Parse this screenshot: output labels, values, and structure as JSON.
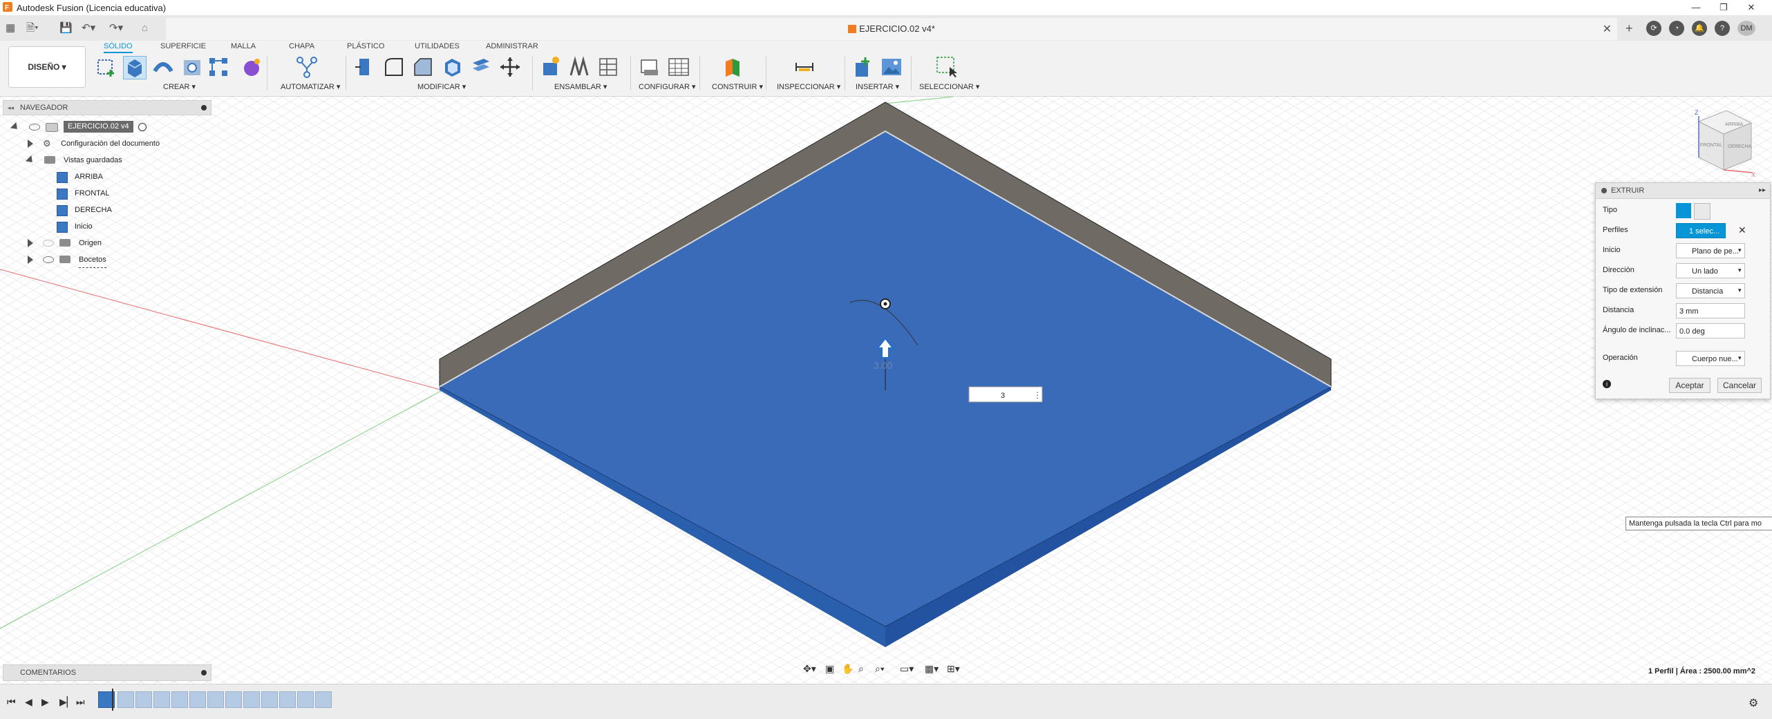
{
  "window": {
    "title": "Autodesk Fusion (Licencia educativa)",
    "controls": [
      "—",
      "❐",
      "✕"
    ]
  },
  "tabbar": {
    "document_title": "EJERCICIO.02 v4*",
    "user_initials": "DM"
  },
  "toolbar": {
    "workspace": "DISEÑO ▾",
    "tabs": [
      "SÓLIDO",
      "SUPERFICIE",
      "MALLA",
      "CHAPA",
      "PLÁSTICO",
      "UTILIDADES",
      "ADMINISTRAR"
    ],
    "groups": [
      "CREAR ▾",
      "AUTOMATIZAR ▾",
      "MODIFICAR ▾",
      "ENSAMBLAR ▾",
      "CONFIGURAR ▾",
      "CONSTRUIR ▾",
      "INSPECCIONAR ▾",
      "INSERTAR ▾",
      "SELECCIONAR ▾"
    ]
  },
  "navigator": {
    "title": "NAVEGADOR",
    "root": "EJERCICIO.02 v4",
    "items": [
      {
        "label": "Configuración del documento"
      },
      {
        "label": "Vistas guardadas"
      },
      {
        "label": "ARRIBA"
      },
      {
        "label": "FRONTAL"
      },
      {
        "label": "DERECHA"
      },
      {
        "label": "Inicio"
      },
      {
        "label": "Origen"
      },
      {
        "label": "Bocetos"
      }
    ]
  },
  "viewport": {
    "dimension_input": "3",
    "ghost_value": "3.00",
    "view_cube": {
      "top": "ARRIBA",
      "front": "FRONTAL",
      "right": "DERECHA",
      "axis_z": "Z",
      "axis_x": "X"
    }
  },
  "extrude_panel": {
    "title": "EXTRUIR",
    "rows": [
      {
        "label": "Tipo",
        "value": ""
      },
      {
        "label": "Perfiles",
        "value": "1 selec..."
      },
      {
        "label": "Inicio",
        "value": "Plano de pe..."
      },
      {
        "label": "Dirección",
        "value": "Un lado"
      },
      {
        "label": "Tipo de extensión",
        "value": "Distancia"
      },
      {
        "label": "Distancia",
        "value": "3 mm"
      },
      {
        "label": "Ángulo de inclinac...",
        "value": "0.0 deg"
      },
      {
        "label": "Operación",
        "value": "Cuerpo nue..."
      }
    ],
    "ok_label": "Aceptar",
    "cancel_label": "Cancelar"
  },
  "tooltip": "Mantenga pulsada la tecla Ctrl para mo",
  "comments": {
    "title": "COMENTARIOS"
  },
  "status": {
    "selection": "1 Perfil | Área : 2500.00 mm^2"
  },
  "colors": {
    "accent": "#0696d7",
    "body_blue": "#3a6bb8",
    "body_side": "#2458a8",
    "wall_gray": "#6f6a64"
  }
}
